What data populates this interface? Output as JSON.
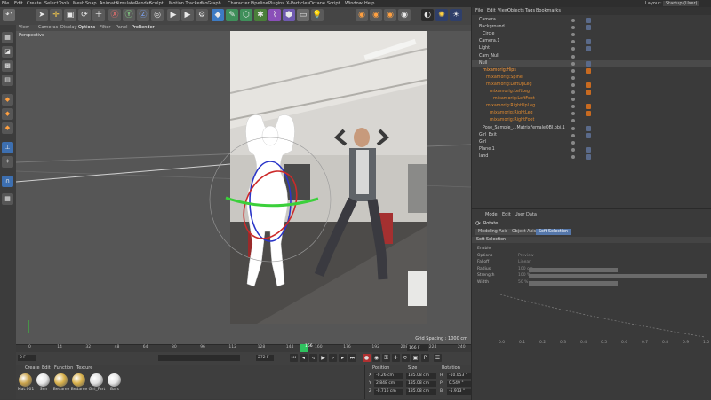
{
  "menubar": {
    "items": [
      "File",
      "Edit",
      "Create",
      "Select",
      "Tools",
      "Mesh",
      "Snap",
      "Animate",
      "Simulate",
      "Render",
      "Sculpt",
      "Motion Tracker",
      "MoGraph",
      "Character",
      "Pipeline",
      "Plugins",
      "X-Particles",
      "Octane",
      "Script",
      "Window",
      "Help"
    ],
    "layout_label": "Layout:",
    "layout_value": "Startup (User)"
  },
  "viewport": {
    "menu": [
      "View",
      "Cameras",
      "Display",
      "Options",
      "Filter",
      "Panel",
      "ProRender"
    ],
    "label": "Perspective",
    "grid_spacing": "Grid Spacing : 1000 cm"
  },
  "timeline": {
    "ticks": [
      "0",
      "14",
      "32",
      "48",
      "64",
      "80",
      "96",
      "112",
      "128",
      "144",
      "160",
      "176",
      "192",
      "208",
      "224",
      "240"
    ],
    "frame_marker": "166",
    "start_field": "0 F",
    "end_field": "272 F",
    "current_field": "166 F"
  },
  "materials": {
    "menu": [
      "Create",
      "Edit",
      "Function",
      "Texture"
    ],
    "items": [
      {
        "label": "Mat.001",
        "color": "#c9a24a"
      },
      {
        "label": "Sen",
        "color": "#e8e8e8"
      },
      {
        "label": "Bedame",
        "color": "#d9b14a"
      },
      {
        "label": "Bedame",
        "color": "#d9b14a"
      },
      {
        "label": "Girl_Fart",
        "color": "#e0e0e0"
      },
      {
        "label": "Bars",
        "color": "#e6e6e6"
      }
    ]
  },
  "coordinates": {
    "headers": [
      "Position",
      "Size",
      "Rotation"
    ],
    "rows": [
      {
        "axis": "X",
        "pos": "-0.26 cm",
        "size": "135.08 cm",
        "rot_label": "H",
        "rot": "-10.053 °"
      },
      {
        "axis": "Y",
        "pos": "2.848 cm",
        "size": "135.08 cm",
        "rot_label": "P",
        "rot": "0.549 °"
      },
      {
        "axis": "Z",
        "pos": "-0.716 cm",
        "size": "135.08 cm",
        "rot_label": "B",
        "rot": "-5.913 °"
      }
    ]
  },
  "object_manager": {
    "menu": [
      "File",
      "Edit",
      "View",
      "Objects",
      "Tags",
      "Bookmarks"
    ],
    "rows": [
      {
        "name": "Camera",
        "color": "#d0d0d0",
        "indent": 0
      },
      {
        "name": "Background",
        "color": "#d0d0d0",
        "indent": 0
      },
      {
        "name": "Circle",
        "color": "#d0d0d0",
        "indent": 1
      },
      {
        "name": "Camera.1",
        "color": "#d0d0d0",
        "indent": 0
      },
      {
        "name": "Light",
        "color": "#d0d0d0",
        "indent": 0
      },
      {
        "name": "Cam_Null",
        "color": "#d0d0d0",
        "indent": 0
      },
      {
        "name": "Null",
        "color": "#d0d0d0",
        "indent": 0
      },
      {
        "name": "mixamorig:Hips",
        "color": "#ff9c3a",
        "indent": 1
      },
      {
        "name": "mixamorig:Spine",
        "color": "#e08a30",
        "indent": 2
      },
      {
        "name": "mixamorig:LeftUpLeg",
        "color": "#e08a30",
        "indent": 2
      },
      {
        "name": "mixamorig:LeftLeg",
        "color": "#e08a30",
        "indent": 3
      },
      {
        "name": "mixamorig:LeftFoot",
        "color": "#e08a30",
        "indent": 4
      },
      {
        "name": "mixamorig:RightUpLeg",
        "color": "#e08a30",
        "indent": 2
      },
      {
        "name": "mixamorig:RightLeg",
        "color": "#e08a30",
        "indent": 3
      },
      {
        "name": "mixamorig:RightFoot",
        "color": "#e08a30",
        "indent": 3
      },
      {
        "name": "Pose_Sample_...MatrixFemaleOBJ.obj.1",
        "color": "#d0d0d0",
        "indent": 1
      },
      {
        "name": "Girl_Exit",
        "color": "#d0d0d0",
        "indent": 0
      },
      {
        "name": "Girl",
        "color": "#d0d0d0",
        "indent": 0
      },
      {
        "name": "Plane.1",
        "color": "#d0d0d0",
        "indent": 0
      },
      {
        "name": "land",
        "color": "#d0d0d0",
        "indent": 0
      }
    ]
  },
  "attributes": {
    "menu": [
      "Mode",
      "Edit",
      "User Data"
    ],
    "title": "Rotate",
    "tabs": [
      "Modeling Axis",
      "Object Axis",
      "Soft Selection"
    ],
    "active_tab": "Soft Selection",
    "section": "Soft Selection",
    "fields": [
      {
        "label": "Enable",
        "value": ""
      },
      {
        "label": "Options",
        "value": "Preview"
      },
      {
        "label": "Falloff",
        "value": "Linear"
      },
      {
        "label": "Radius",
        "value": "100 cm"
      },
      {
        "label": "Strength",
        "value": "100 %"
      },
      {
        "label": "Width",
        "value": "50 %"
      }
    ],
    "graph_ticks": [
      "0.0",
      "0.1",
      "0.2",
      "0.3",
      "0.4",
      "0.5",
      "0.6",
      "0.7",
      "0.8",
      "0.9",
      "1.0"
    ]
  }
}
